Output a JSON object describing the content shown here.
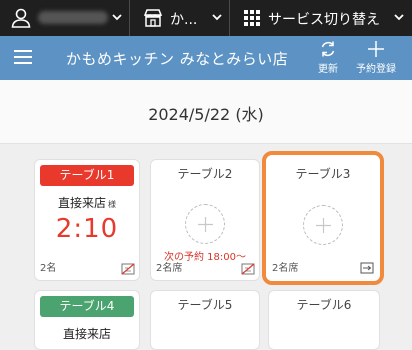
{
  "topbar": {
    "store_label": "か...",
    "service_label": "サービス切り替え"
  },
  "header": {
    "store_title": "かもめキッチン みなとみらい店",
    "refresh_label": "更新",
    "reserve_label": "予約登録"
  },
  "date": "2024/5/22 (水)",
  "tables": [
    {
      "name": "テーブル1",
      "status": "occupied",
      "visit_label": "直接来店",
      "honorific": "様",
      "timer": "2:10",
      "seats": "2名"
    },
    {
      "name": "テーブル2",
      "status": "empty",
      "next_reservation": "次の予約 18:00〜",
      "seats": "2名席"
    },
    {
      "name": "テーブル3",
      "status": "empty",
      "selected": true,
      "seats": "2名席"
    },
    {
      "name": "テーブル4",
      "status": "occupied",
      "visit_label": "直接来店"
    },
    {
      "name": "テーブル5",
      "status": "empty"
    },
    {
      "name": "テーブル6",
      "status": "empty"
    }
  ],
  "colors": {
    "accent": "#5d93c4",
    "occupied_red": "#e8392c",
    "occupied_green": "#4ba36f",
    "selected_border": "#f08a3c"
  }
}
